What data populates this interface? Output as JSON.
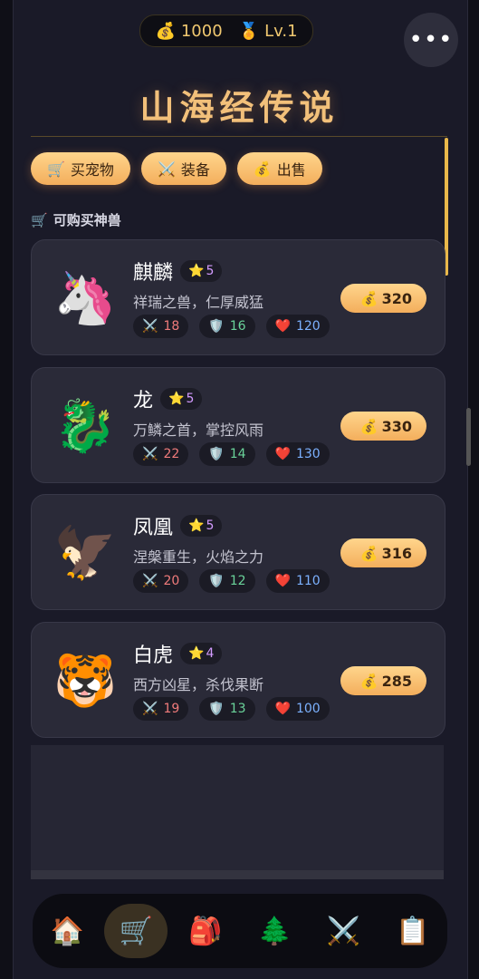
{
  "topbar": {
    "coins": "1000",
    "level": "Lv.1",
    "coin_icon": "💰",
    "level_icon": "🏅"
  },
  "menu": {
    "label": "•••"
  },
  "title": "山海经传说",
  "tabs": [
    {
      "icon": "🛒",
      "label": "买宠物"
    },
    {
      "icon": "⚔️",
      "label": "装备"
    },
    {
      "icon": "💰",
      "label": "出售"
    }
  ],
  "section": {
    "icon": "🛒",
    "label": "可购买神兽"
  },
  "pets": [
    {
      "emoji": "🦄",
      "name": "麒麟",
      "stars": "5",
      "desc": "祥瑞之兽，仁厚威猛",
      "atk": "18",
      "def": "16",
      "hp": "120",
      "price": "320"
    },
    {
      "emoji": "🐉",
      "name": "龙",
      "stars": "5",
      "desc": "万鳞之首，掌控风雨",
      "atk": "22",
      "def": "14",
      "hp": "130",
      "price": "330"
    },
    {
      "emoji": "🦅",
      "name": "凤凰",
      "stars": "5",
      "desc": "涅槃重生，火焰之力",
      "atk": "20",
      "def": "12",
      "hp": "110",
      "price": "316"
    },
    {
      "emoji": "🐯",
      "name": "白虎",
      "stars": "4",
      "desc": "西方凶星，杀伐果断",
      "atk": "19",
      "def": "13",
      "hp": "100",
      "price": "285"
    }
  ],
  "icons": {
    "star": "⭐",
    "atk": "⚔️",
    "def": "🛡️",
    "hp": "❤️",
    "coin": "💰"
  },
  "nav": [
    {
      "icon": "🏠",
      "name": "home"
    },
    {
      "icon": "🛒",
      "name": "shop"
    },
    {
      "icon": "🎒",
      "name": "bag"
    },
    {
      "icon": "🌲",
      "name": "explore"
    },
    {
      "icon": "⚔️",
      "name": "battle"
    },
    {
      "icon": "📋",
      "name": "tasks"
    }
  ]
}
